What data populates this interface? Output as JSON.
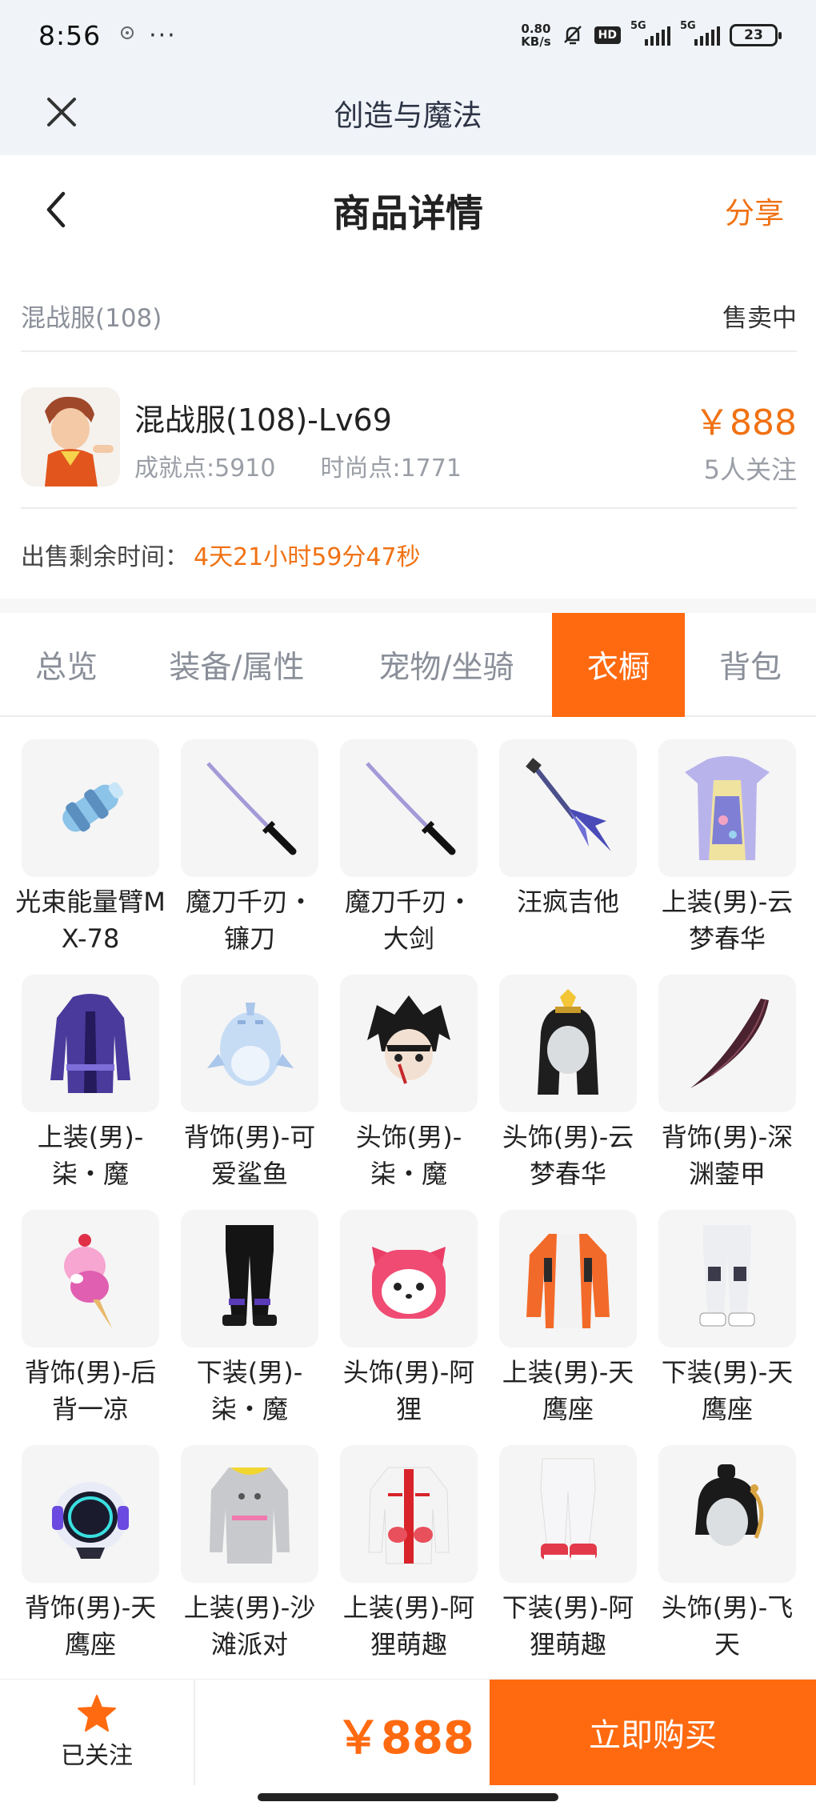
{
  "status_bar": {
    "time": "8:56",
    "dots": "···",
    "net_speed_value": "0.80",
    "net_speed_unit": "KB/s",
    "hd_label": "HD",
    "signal1_label": "5G",
    "signal2_label": "5G",
    "battery": "23"
  },
  "app_bar": {
    "title": "创造与魔法"
  },
  "header": {
    "title": "商品详情",
    "share_label": "分享"
  },
  "server": {
    "name": "混战服(108)",
    "status": "售卖中"
  },
  "product": {
    "name": "混战服(108)-Lv69",
    "achievement": "成就点:5910",
    "fashion": "时尚点:1771",
    "price": "￥888",
    "followers": "5人关注"
  },
  "remaining": {
    "label": "出售剩余时间：",
    "value": "4天21小时59分47秒"
  },
  "tabs": [
    "总览",
    "装备/属性",
    "宠物/坐骑",
    "衣橱",
    "背包"
  ],
  "active_tab": 3,
  "items": [
    {
      "name": "光束能量臂MX-78",
      "icon": "energy-arm-icon"
    },
    {
      "name": "魔刀千刃・镰刀",
      "icon": "katana-icon"
    },
    {
      "name": "魔刀千刃・大剑",
      "icon": "katana-icon"
    },
    {
      "name": "汪疯吉他",
      "icon": "guitar-icon"
    },
    {
      "name": "上装(男)-云梦春华",
      "icon": "robe-icon"
    },
    {
      "name": "上装(男)-柒・魔",
      "icon": "coat-icon"
    },
    {
      "name": "背饰(男)-可爱鲨鱼",
      "icon": "shark-icon"
    },
    {
      "name": "头饰(男)-柒・魔",
      "icon": "hair-icon"
    },
    {
      "name": "头饰(男)-云梦春华",
      "icon": "headdress-icon"
    },
    {
      "name": "背饰(男)-深渊蓥甲",
      "icon": "blade-icon"
    },
    {
      "name": "背饰(男)-后背一凉",
      "icon": "icecream-icon"
    },
    {
      "name": "下装(男)-柒・魔",
      "icon": "pants-icon"
    },
    {
      "name": "头饰(男)-阿狸",
      "icon": "fox-icon"
    },
    {
      "name": "上装(男)-天鹰座",
      "icon": "jacket-icon"
    },
    {
      "name": "下装(男)-天鹰座",
      "icon": "pants-icon"
    },
    {
      "name": "背饰(男)-天鹰座",
      "icon": "device-icon"
    },
    {
      "name": "上装(男)-沙滩派对",
      "icon": "hoodie-icon"
    },
    {
      "name": "上装(男)-阿狸萌趣",
      "icon": "jacket-icon"
    },
    {
      "name": "下装(男)-阿狸萌趣",
      "icon": "pants-icon"
    },
    {
      "name": "头饰(男)-飞天",
      "icon": "headdress-icon"
    }
  ],
  "bottom": {
    "follow_label": "已关注",
    "price": "￥888",
    "buy_label": "立即购买"
  },
  "colors": {
    "accent": "#ff6a10",
    "price": "#f07214",
    "header_bg": "#f0f4f9"
  }
}
